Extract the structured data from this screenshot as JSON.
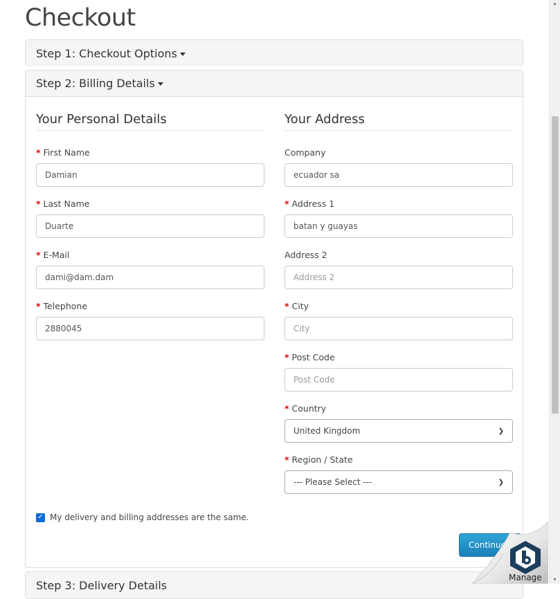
{
  "page": {
    "title": "Checkout"
  },
  "steps": {
    "step1": "Step 1: Checkout Options",
    "step2": "Step 2: Billing Details",
    "step3": "Step 3: Delivery Details"
  },
  "personal": {
    "legend": "Your Personal Details",
    "first_name": {
      "label": "First Name",
      "value": "Damian"
    },
    "last_name": {
      "label": "Last Name",
      "value": "Duarte"
    },
    "email": {
      "label": "E-Mail",
      "value": "dami@dam.dam"
    },
    "telephone": {
      "label": "Telephone",
      "value": "2880045"
    }
  },
  "address": {
    "legend": "Your Address",
    "company": {
      "label": "Company",
      "value": "ecuador sa"
    },
    "address1": {
      "label": "Address 1",
      "value": "batan y guayas"
    },
    "address2": {
      "label": "Address 2",
      "placeholder": "Address 2"
    },
    "city": {
      "label": "City",
      "placeholder": "City"
    },
    "postcode": {
      "label": "Post Code",
      "placeholder": "Post Code"
    },
    "country": {
      "label": "Country",
      "selected": "United Kingdom"
    },
    "region": {
      "label": "Region / State",
      "selected": "--- Please Select ---"
    }
  },
  "same_address": {
    "label": "My delivery and billing addresses are the same.",
    "checked": true
  },
  "continue_label": "Continue",
  "manage_label": "Manage",
  "required_mark": "*",
  "colors": {
    "accent": "#1b7fb8",
    "required": "#ee0000",
    "checkbox": "#0b6cd8"
  }
}
